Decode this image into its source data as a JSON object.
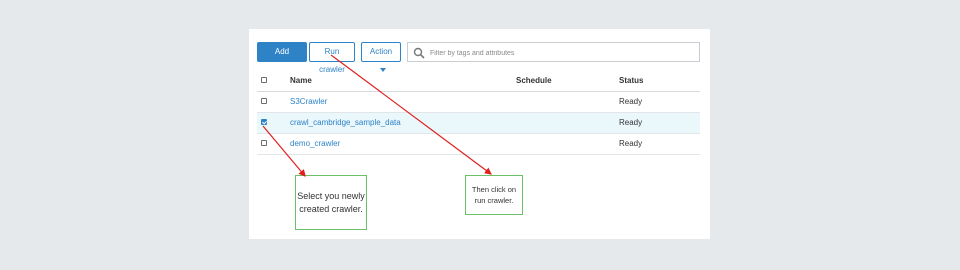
{
  "toolbar": {
    "add_label": "Add crawler",
    "run_label": "Run crawler",
    "action_label": "Action",
    "search_placeholder": "Filter by tags and attributes"
  },
  "table": {
    "headers": {
      "name": "Name",
      "schedule": "Schedule",
      "status": "Status"
    },
    "rows": [
      {
        "name": "S3Crawler",
        "schedule": "",
        "status": "Ready",
        "checked": false
      },
      {
        "name": "crawl_cambridge_sample_data",
        "schedule": "",
        "status": "Ready",
        "checked": true
      },
      {
        "name": "demo_crawler",
        "schedule": "",
        "status": "Ready",
        "checked": false
      }
    ]
  },
  "annotations": {
    "select_note": "Select you newly created crawler.",
    "run_note": "Then click on run crawler."
  },
  "colors": {
    "accent": "#2e83c7",
    "arrow": "#e02020",
    "callout_border": "#6abf69",
    "selected_row": "#eaf7fb"
  }
}
